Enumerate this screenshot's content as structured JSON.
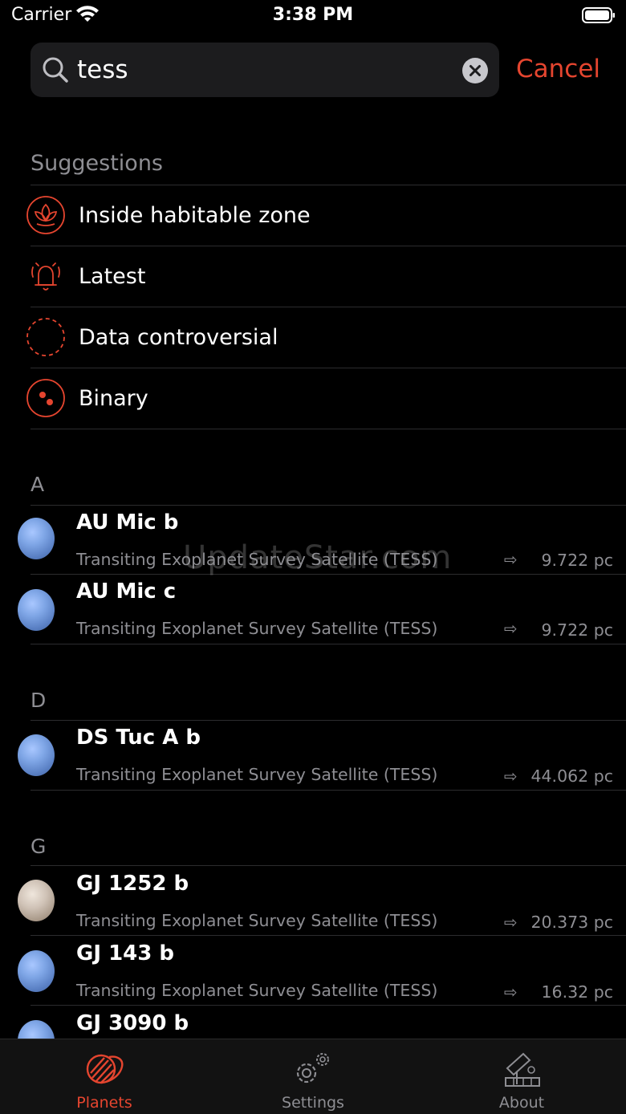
{
  "status_bar": {
    "carrier": "Carrier",
    "time": "3:38 PM"
  },
  "search": {
    "value": "tess",
    "placeholder": "Search",
    "cancel_label": "Cancel"
  },
  "suggestions": {
    "title": "Suggestions",
    "items": [
      {
        "label": "Inside habitable zone",
        "icon": "lotus-icon"
      },
      {
        "label": "Latest",
        "icon": "bell-icon"
      },
      {
        "label": "Data controversial",
        "icon": "dashed-circle-icon"
      },
      {
        "label": "Binary",
        "icon": "binary-dots-icon"
      }
    ]
  },
  "sections": [
    {
      "letter": "A",
      "planets": [
        {
          "name": "AU Mic b",
          "mission": "Transiting Exoplanet Survey Satellite (TESS)",
          "distance": "9.722 pc",
          "arrow": "⇨"
        },
        {
          "name": "AU Mic c",
          "mission": "Transiting Exoplanet Survey Satellite (TESS)",
          "distance": "9.722 pc",
          "arrow": "⇨"
        }
      ]
    },
    {
      "letter": "D",
      "planets": [
        {
          "name": "DS Tuc A b",
          "mission": "Transiting Exoplanet Survey Satellite (TESS)",
          "distance": "44.062 pc",
          "arrow": "⇨"
        }
      ]
    },
    {
      "letter": "G",
      "planets": [
        {
          "name": "GJ 1252 b",
          "mission": "Transiting Exoplanet Survey Satellite (TESS)",
          "distance": "20.373 pc",
          "arrow": "⇨"
        },
        {
          "name": "GJ 143 b",
          "mission": "Transiting Exoplanet Survey Satellite (TESS)",
          "distance": "16.32 pc",
          "arrow": "⇨"
        },
        {
          "name": "GJ 3090 b"
        }
      ]
    }
  ],
  "watermark": "UpdateStar.com",
  "tabbar": {
    "tabs": [
      {
        "label": "Planets",
        "active": true
      },
      {
        "label": "Settings",
        "active": false
      },
      {
        "label": "About",
        "active": false
      }
    ]
  },
  "colors": {
    "accent": "#e5452f",
    "inactive": "#8e8e93",
    "background": "#000000"
  }
}
